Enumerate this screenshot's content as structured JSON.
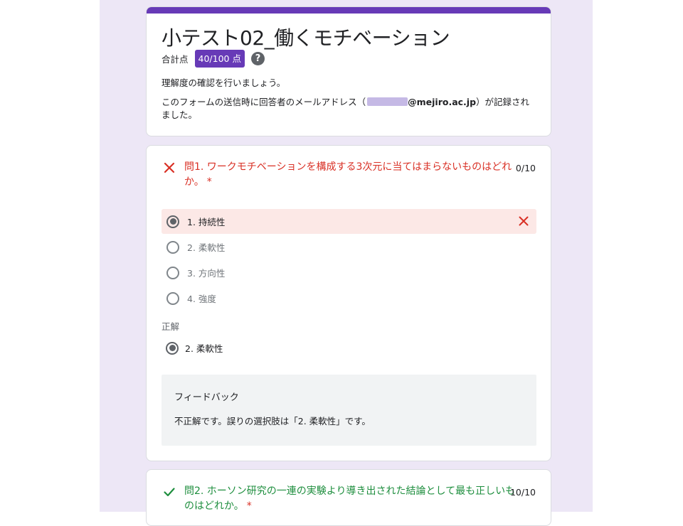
{
  "colors": {
    "accent": "#673ab7",
    "error": "#d93025",
    "success": "#1e8e3e",
    "page_background": "#ede7f6"
  },
  "header": {
    "title": "小テスト02_働くモチベーション",
    "score_label": "合計点",
    "score_value": "40/100 点",
    "help_icon": "help-circle-icon",
    "description": "理解度の確認を行いましょう。",
    "email_note_before": "このフォームの送信時に回答者のメールアドレス（",
    "email_domain": "@mejiro.ac.jp",
    "email_note_after": "）が記録されました。"
  },
  "questions": [
    {
      "status_icon": "incorrect-x-icon",
      "title": "問1. ワークモチベーションを構成する3次元に当てはまらないものはどれか。",
      "required_mark": "*",
      "points": "0/10",
      "options": [
        {
          "label": "1. 持続性",
          "selected": true,
          "marked_wrong": true
        },
        {
          "label": "2. 柔軟性",
          "selected": false
        },
        {
          "label": "3. 方向性",
          "selected": false
        },
        {
          "label": "4. 強度",
          "selected": false
        }
      ],
      "correct_answer_heading": "正解",
      "correct_answer": "2. 柔軟性",
      "feedback_title": "フィードバック",
      "feedback_text": "不正解です。誤りの選択肢は「2. 柔軟性」です。"
    },
    {
      "status_icon": "correct-check-icon",
      "title": "問2. ホーソン研究の一連の実験より導き出された結論として最も正しいものはどれか。",
      "required_mark": "*",
      "points": "10/10"
    }
  ]
}
